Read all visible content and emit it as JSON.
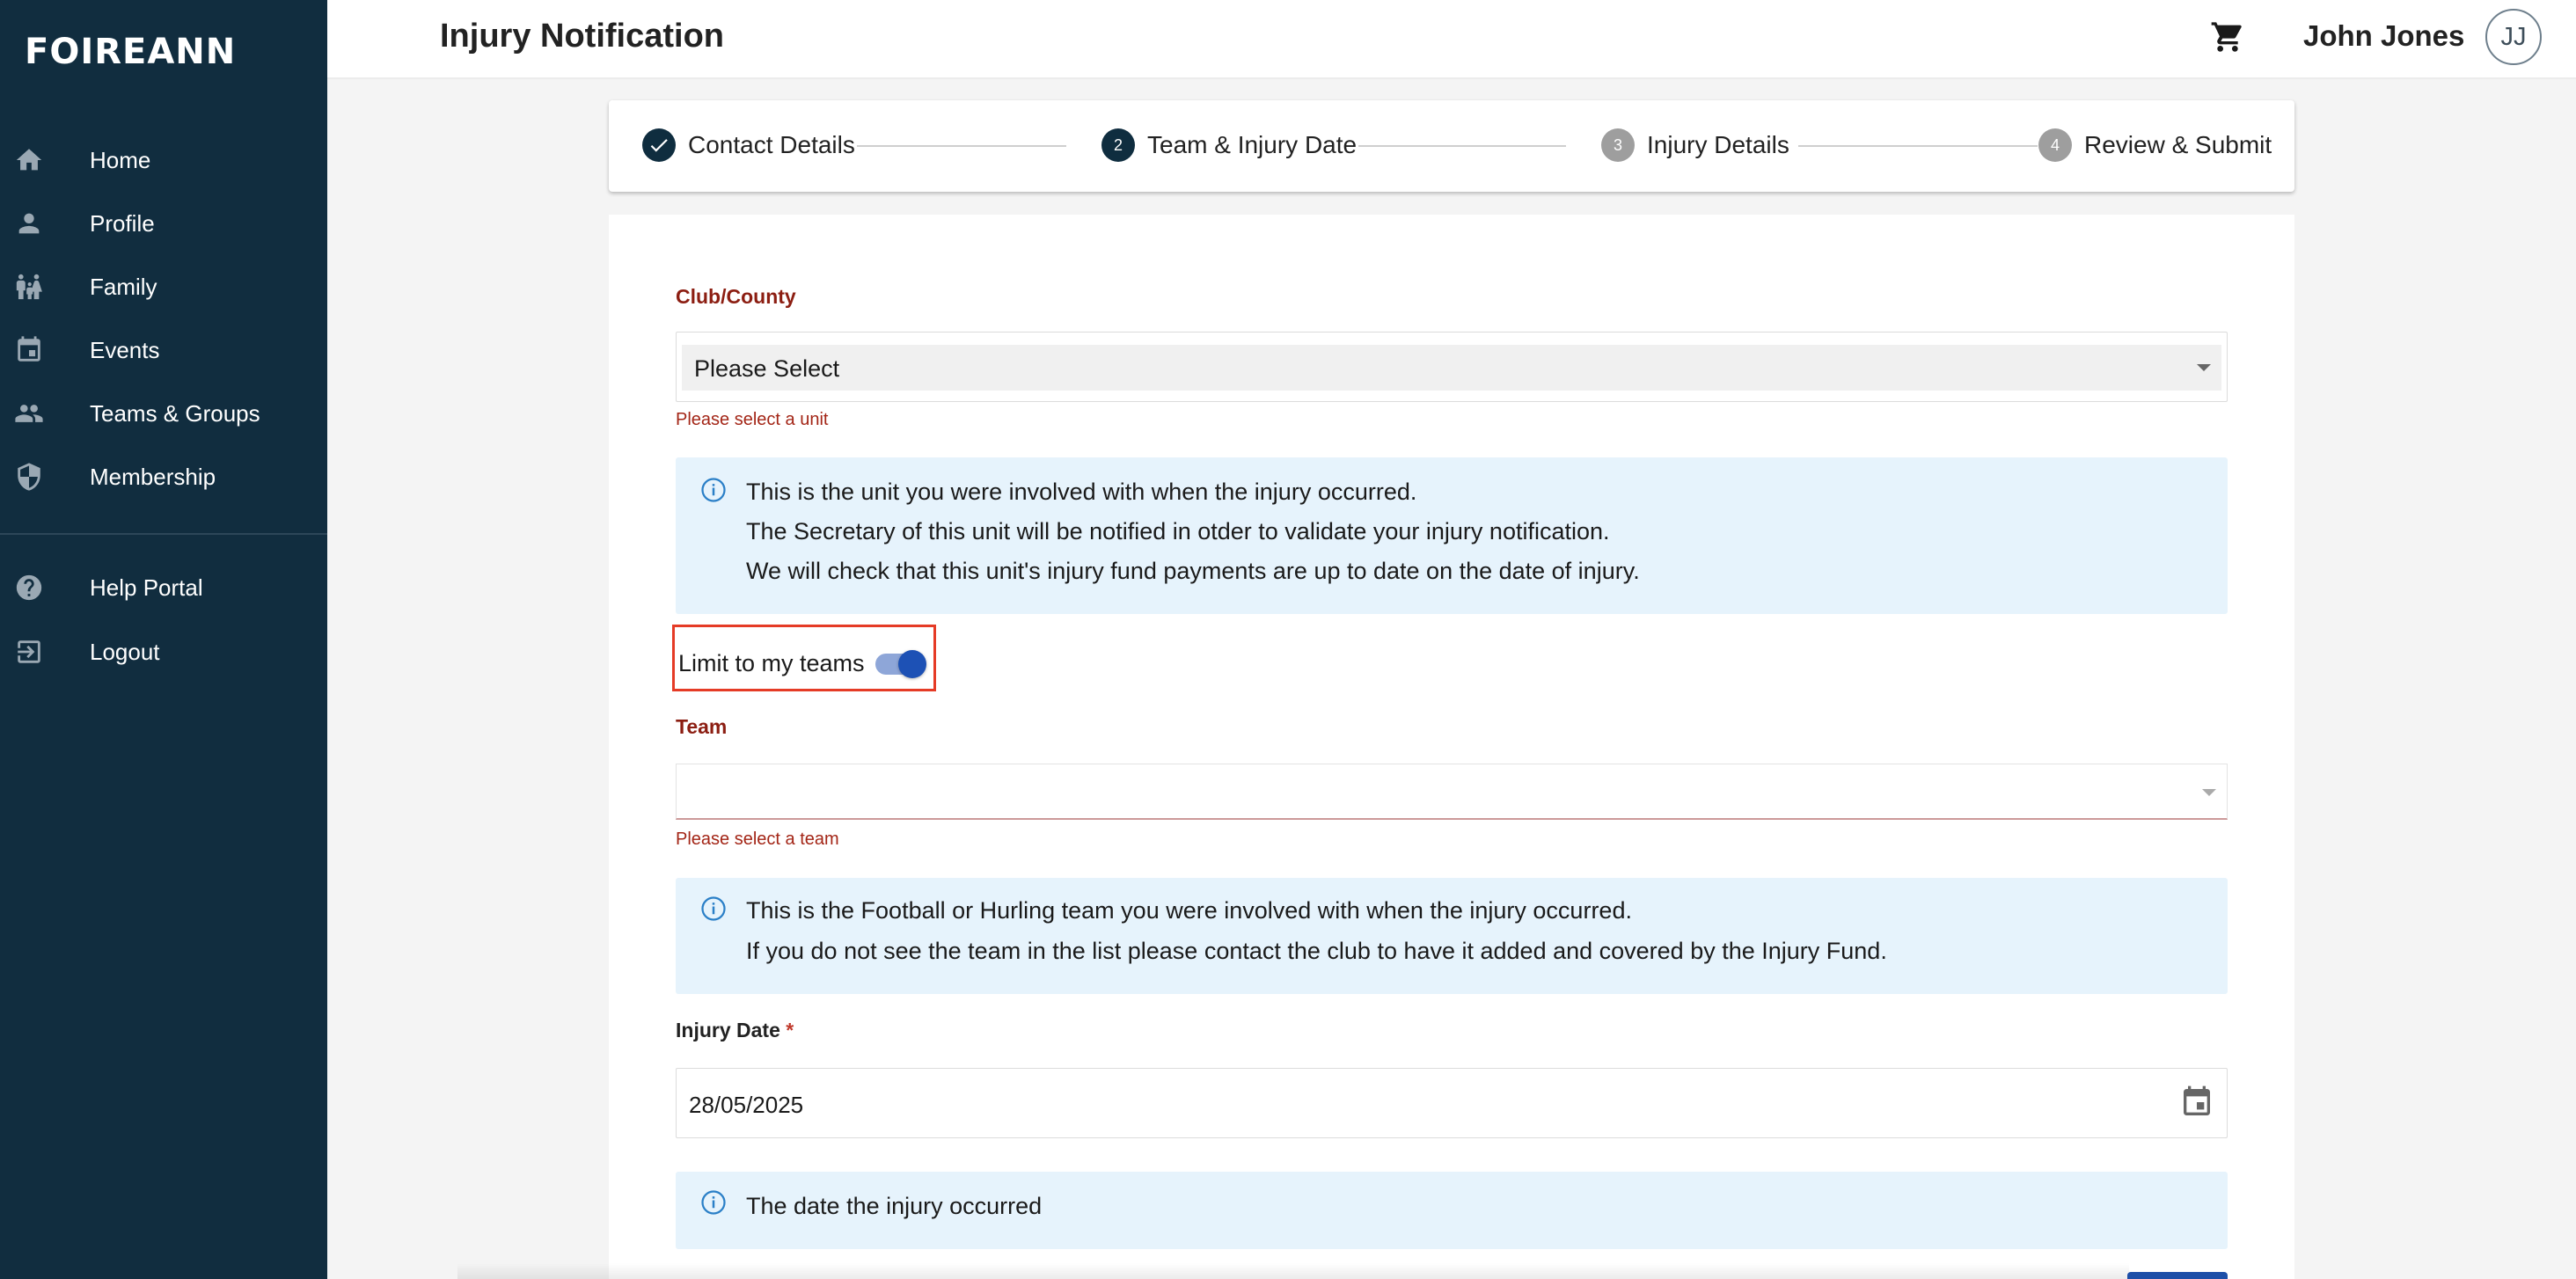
{
  "app": {
    "logo": "FOIREANN",
    "page_title": "Injury Notification",
    "user_name": "John Jones",
    "user_initials": "JJ"
  },
  "sidebar": {
    "items": [
      {
        "label": "Home",
        "icon": "home-icon"
      },
      {
        "label": "Profile",
        "icon": "person-icon"
      },
      {
        "label": "Family",
        "icon": "family-icon"
      },
      {
        "label": "Events",
        "icon": "calendar-icon"
      },
      {
        "label": "Teams & Groups",
        "icon": "group-icon"
      },
      {
        "label": "Membership",
        "icon": "shield-icon"
      }
    ],
    "secondary": [
      {
        "label": "Help Portal",
        "icon": "help-icon"
      },
      {
        "label": "Logout",
        "icon": "logout-icon"
      }
    ]
  },
  "stepper": {
    "steps": [
      {
        "number": "",
        "label": "Contact Details",
        "state": "done"
      },
      {
        "number": "2",
        "label": "Team & Injury Date",
        "state": "active"
      },
      {
        "number": "3",
        "label": "Injury Details",
        "state": "todo"
      },
      {
        "number": "4",
        "label": "Review & Submit",
        "state": "todo"
      }
    ]
  },
  "form": {
    "club_county": {
      "label": "Club/County",
      "value": "Please Select",
      "error": "Please select a unit",
      "info": [
        "This is the unit you were involved with when the injury occurred.",
        "The Secretary of this unit will be notified in otder to validate your injury notification.",
        "We will check that this unit's injury fund payments are up to date on the date of injury."
      ]
    },
    "limit_toggle": {
      "label": "Limit to my teams",
      "checked": true
    },
    "team": {
      "label": "Team",
      "value": "",
      "error": "Please select a team",
      "info": [
        "This is the Football or Hurling team you were involved with when the injury occurred.",
        "If you do not see the team in the list please contact the club to have it added and covered by the Injury Fund."
      ]
    },
    "injury_date": {
      "label": "Injury Date",
      "required_mark": "*",
      "value": "28/05/2025",
      "info": [
        "The date the injury occurred"
      ]
    }
  },
  "colors": {
    "sidebar_bg": "#112d3f",
    "label_red": "#8c1e12",
    "info_bg": "#e6f3fc",
    "toggle_blue": "#1d51b5",
    "highlight_border": "#e53b26"
  }
}
